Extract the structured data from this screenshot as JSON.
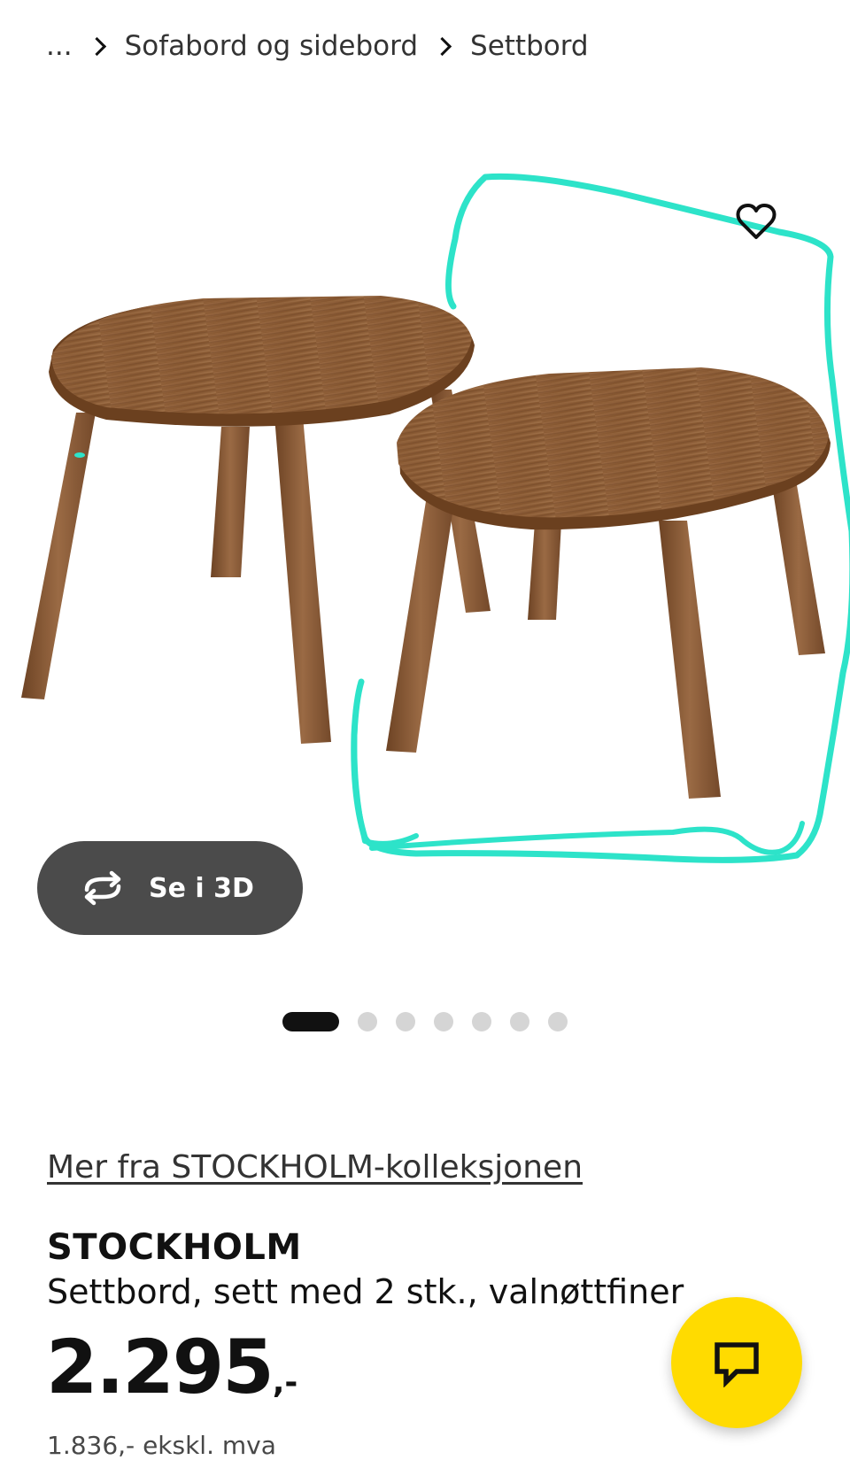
{
  "breadcrumb": {
    "ellipsis": "...",
    "items": [
      "Sofabord og sidebord",
      "Settbord"
    ]
  },
  "gallery": {
    "image_alt": "STOCKHOLM settbord i valnøttfiner",
    "favorite_icon": "heart-icon",
    "view3d_label": "Se i 3D",
    "view3d_icon": "rotate-3d-icon",
    "slide_count": 7,
    "active_slide": 1
  },
  "product": {
    "collection_link": "Mer fra STOCKHOLM-kolleksjonen",
    "name": "STOCKHOLM",
    "description": "Settbord, sett med 2 stk., valnøttfiner",
    "price_integer": "2.295",
    "price_decimal": ",-",
    "price_ex_vat": "1.836,- ekskl. mva"
  },
  "chat": {
    "icon": "chat-bubble-icon"
  },
  "colors": {
    "annotation": "#2de3c9",
    "wood": "#8a5a34",
    "chat_bg": "#ffdb00",
    "view3d_bg": "#4b4b4b"
  }
}
